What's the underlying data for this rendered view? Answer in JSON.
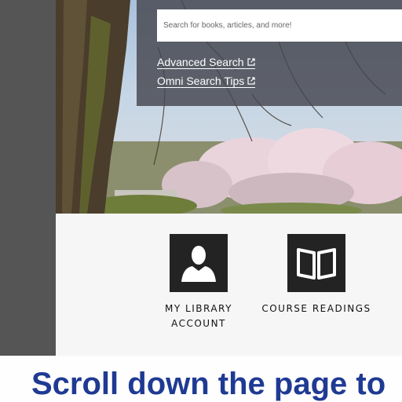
{
  "search": {
    "placeholder": "Search for books, articles, and more!"
  },
  "links": {
    "advanced_search": "Advanced Search",
    "omni_search_tips": "Omni Search Tips",
    "external_icon": "external-link-icon"
  },
  "tiles": [
    {
      "label": "MY LIBRARY ACCOUNT",
      "icon": "person-icon"
    },
    {
      "label": "COURSE READINGS",
      "icon": "open-book-icon"
    }
  ],
  "caption": "Scroll down the page to",
  "colors": {
    "overlay": "#555555",
    "caption": "#1f3a93",
    "tile_icon_bg": "#232323",
    "panel_bg": "#f6f6f6"
  }
}
